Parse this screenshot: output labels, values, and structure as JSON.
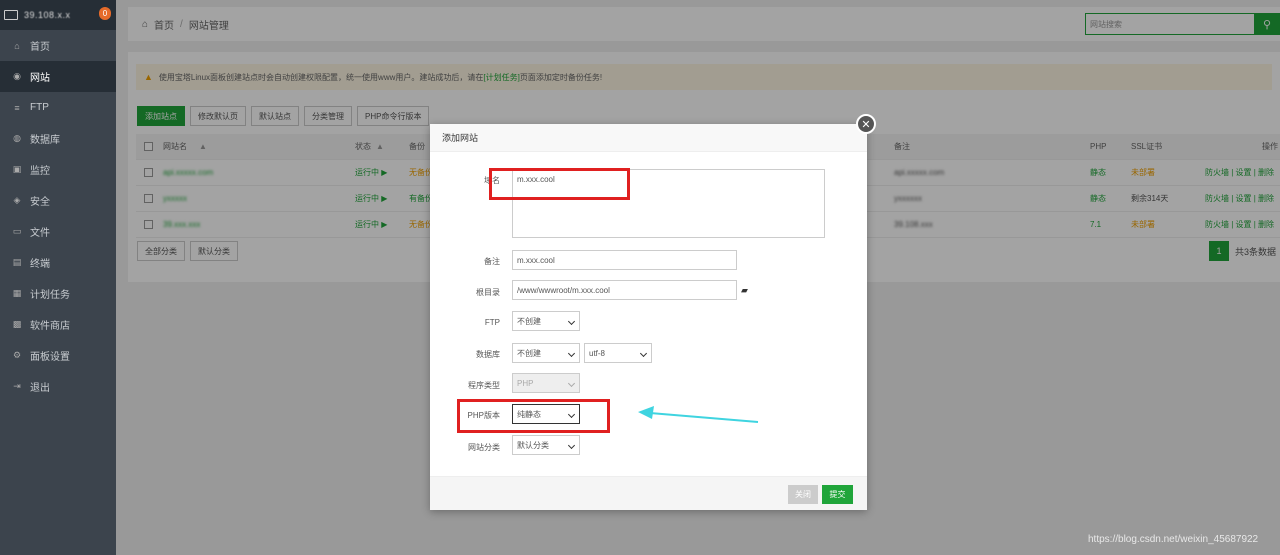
{
  "sidebar": {
    "server_ip": "39.108.x.x",
    "badge": "0",
    "items": [
      {
        "label": "首页",
        "icon": "home-icon",
        "glyph": "⌂"
      },
      {
        "label": "网站",
        "icon": "globe-icon",
        "glyph": "◉"
      },
      {
        "label": "FTP",
        "icon": "ftp-icon",
        "glyph": "≡"
      },
      {
        "label": "数据库",
        "icon": "database-icon",
        "glyph": "◍"
      },
      {
        "label": "监控",
        "icon": "monitor-icon",
        "glyph": "▣"
      },
      {
        "label": "安全",
        "icon": "shield-icon",
        "glyph": "◈"
      },
      {
        "label": "文件",
        "icon": "folder-icon",
        "glyph": "▭"
      },
      {
        "label": "终端",
        "icon": "terminal-icon",
        "glyph": "▤"
      },
      {
        "label": "计划任务",
        "icon": "calendar-icon",
        "glyph": "▦"
      },
      {
        "label": "软件商店",
        "icon": "apps-icon",
        "glyph": "▩"
      },
      {
        "label": "面板设置",
        "icon": "gear-icon",
        "glyph": "⚙"
      },
      {
        "label": "退出",
        "icon": "logout-icon",
        "glyph": "⇥"
      }
    ]
  },
  "header": {
    "home": "首页",
    "sep": "/",
    "current": "网站管理",
    "search_placeholder": "网站搜索"
  },
  "notice": {
    "text1": "使用宝塔Linux面板创建站点时会自动创建权限配置，统一使用www用户。建站成功后，请在",
    "link": "[计划任务]",
    "text2": "页面添加定时备份任务!"
  },
  "toolbar": [
    "添加站点",
    "修改默认页",
    "默认站点",
    "分类管理",
    "PHP命令行版本"
  ],
  "table": {
    "headers": {
      "name": "网站名",
      "status": "状态",
      "backup": "备份",
      "remark": "备注",
      "php": "PHP",
      "ssl": "SSL证书",
      "ops": "操作"
    },
    "rows": [
      {
        "name": "api.xxxxx.com",
        "status": "运行中 ▶",
        "backup": "无备份",
        "remark": "api.xxxxx.com",
        "php": "静态",
        "ssl": "未部署",
        "ops": "防火墙 | 设置 | 删除"
      },
      {
        "name": "yxxxxx",
        "status": "运行中 ▶",
        "backup": "有备份",
        "remark": "yxxxxxx",
        "php": "静态",
        "ssl": "剩余314天",
        "ops": "防火墙 | 设置 | 删除"
      },
      {
        "name": "39.xxx.xxx",
        "status": "运行中 ▶",
        "backup": "无备份",
        "remark": "39.108.xxx",
        "php": "7.1",
        "ssl": "未部署",
        "ops": "防火墙 | 设置 | 删除"
      }
    ]
  },
  "footer": {
    "all_category": "全部分类",
    "default_category": "默认分类",
    "page": "1",
    "total": "共3条数据"
  },
  "modal": {
    "title": "添加网站",
    "domain_label": "域名",
    "domain_value": "m.xxx.cool",
    "remark_label": "备注",
    "remark_value": "m.xxx.cool",
    "root_label": "根目录",
    "root_value": "/www/wwwroot/m.xxx.cool",
    "ftp_label": "FTP",
    "ftp_value": "不创建",
    "db_label": "数据库",
    "db_value": "不创建",
    "charset_value": "utf-8",
    "prog_label": "程序类型",
    "prog_value": "PHP",
    "php_label": "PHP版本",
    "php_value": "纯静态",
    "cat_label": "网站分类",
    "cat_value": "默认分类",
    "close_btn": "关闭",
    "submit_btn": "提交"
  },
  "watermark": "https://blog.csdn.net/weixin_45687922",
  "colors": {
    "brand": "#20a53a",
    "annotation_red": "#e02020",
    "arrow": "#3fd4e0"
  }
}
